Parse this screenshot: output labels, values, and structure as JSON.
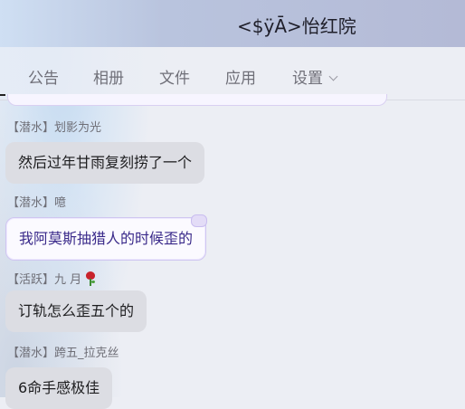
{
  "header": {
    "title": "<$ÿĀ>怡红院"
  },
  "nav": {
    "items": [
      "公告",
      "相册",
      "文件",
      "应用",
      "设置"
    ]
  },
  "messages": [
    {
      "badge": "【潜水】",
      "name": "划影为光",
      "text": "然后过年甘雨复刻捞了一个"
    },
    {
      "badge": "【潜水】",
      "name": "噫",
      "text": "我阿莫斯抽猎人的时候歪的"
    },
    {
      "badge": "【活跃】",
      "name": "九  月",
      "text": "订轨怎么歪五个的"
    },
    {
      "badge": "【潜水】",
      "name": "跨五_拉克丝",
      "text": "6命手感极佳"
    }
  ],
  "icons": {
    "settings_dropdown": "chevron-down-icon",
    "name_emoji": "rose-icon"
  }
}
